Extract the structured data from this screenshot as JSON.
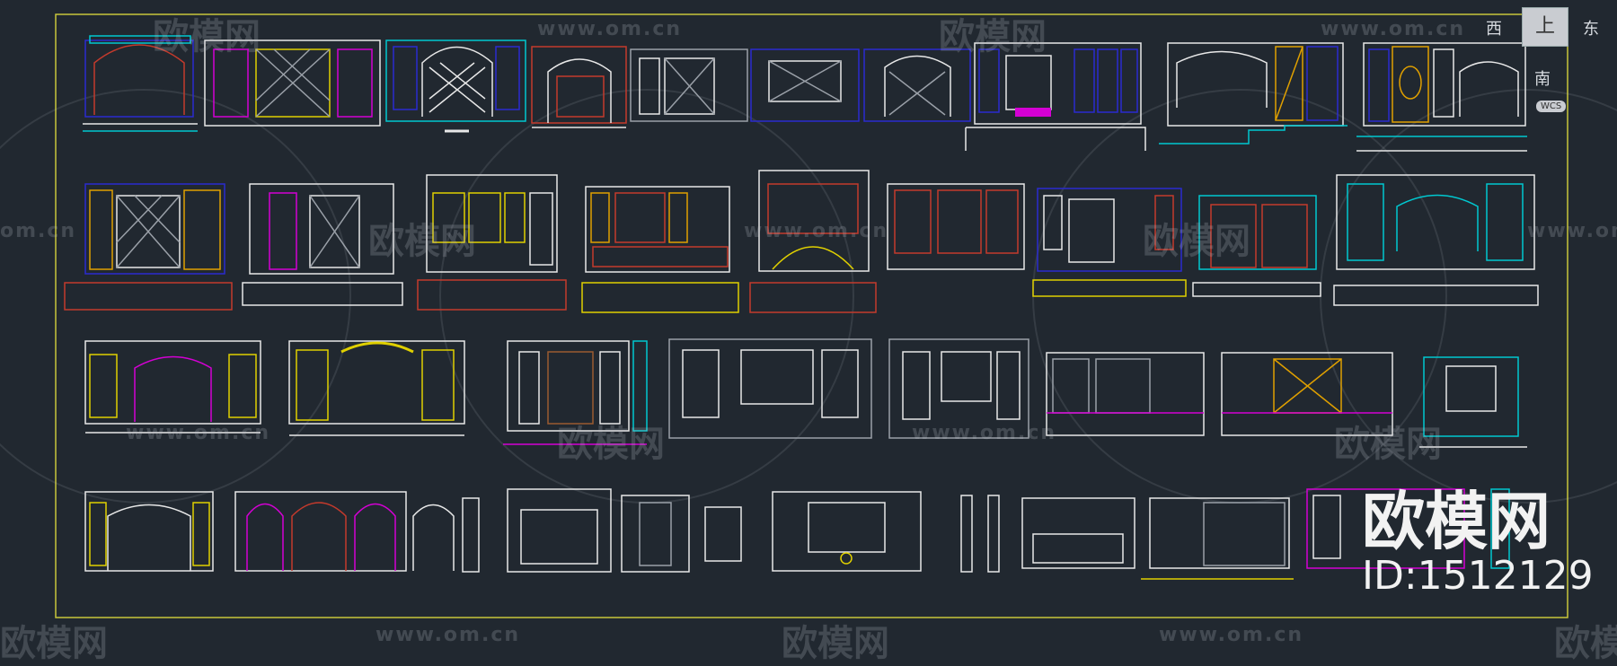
{
  "watermark": {
    "logo_text": "欧模网",
    "url_text": "www.om.cn",
    "url_text_short": "om.cn"
  },
  "viewcube": {
    "top": "上",
    "west": "西",
    "east": "东",
    "south": "南",
    "wcs": "WCS"
  },
  "brand": {
    "logo": "欧模网",
    "id": "ID:1512129"
  },
  "colors": {
    "background": "#212830",
    "frame": "#d4d23a",
    "white": "#e8e8e8",
    "red": "#c43a2c",
    "blue": "#2a2ad0",
    "magenta": "#d400d4",
    "cyan": "#00c8d0",
    "yellow": "#e0d000",
    "green": "#20c020",
    "gray": "#9aa0a8"
  }
}
